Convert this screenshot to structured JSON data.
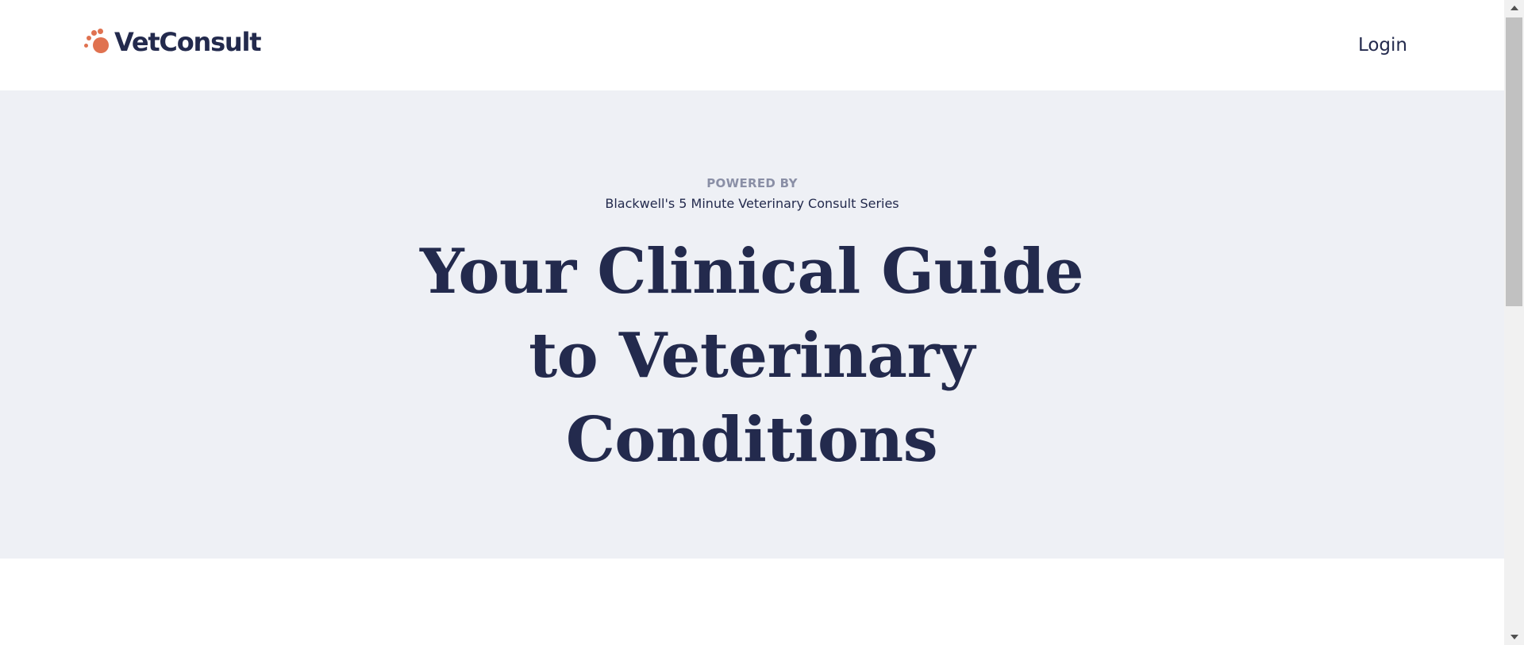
{
  "header": {
    "brand": "VetConsult",
    "login_label": "Login"
  },
  "hero": {
    "powered_label": "POWERED BY",
    "series_label": "Blackwell's 5 Minute Veterinary Consult Series",
    "headline": "Your Clinical Guide to Veterinary Conditions"
  },
  "icons": {
    "logo": "paw-print-icon",
    "scroll_up": "triangle-up-icon",
    "scroll_down": "triangle-down-icon"
  },
  "colors": {
    "brand_accent": "#e07250",
    "navy_text": "#232a4d",
    "hero_background": "#eef0f5",
    "muted_text": "#8a8fa6"
  }
}
